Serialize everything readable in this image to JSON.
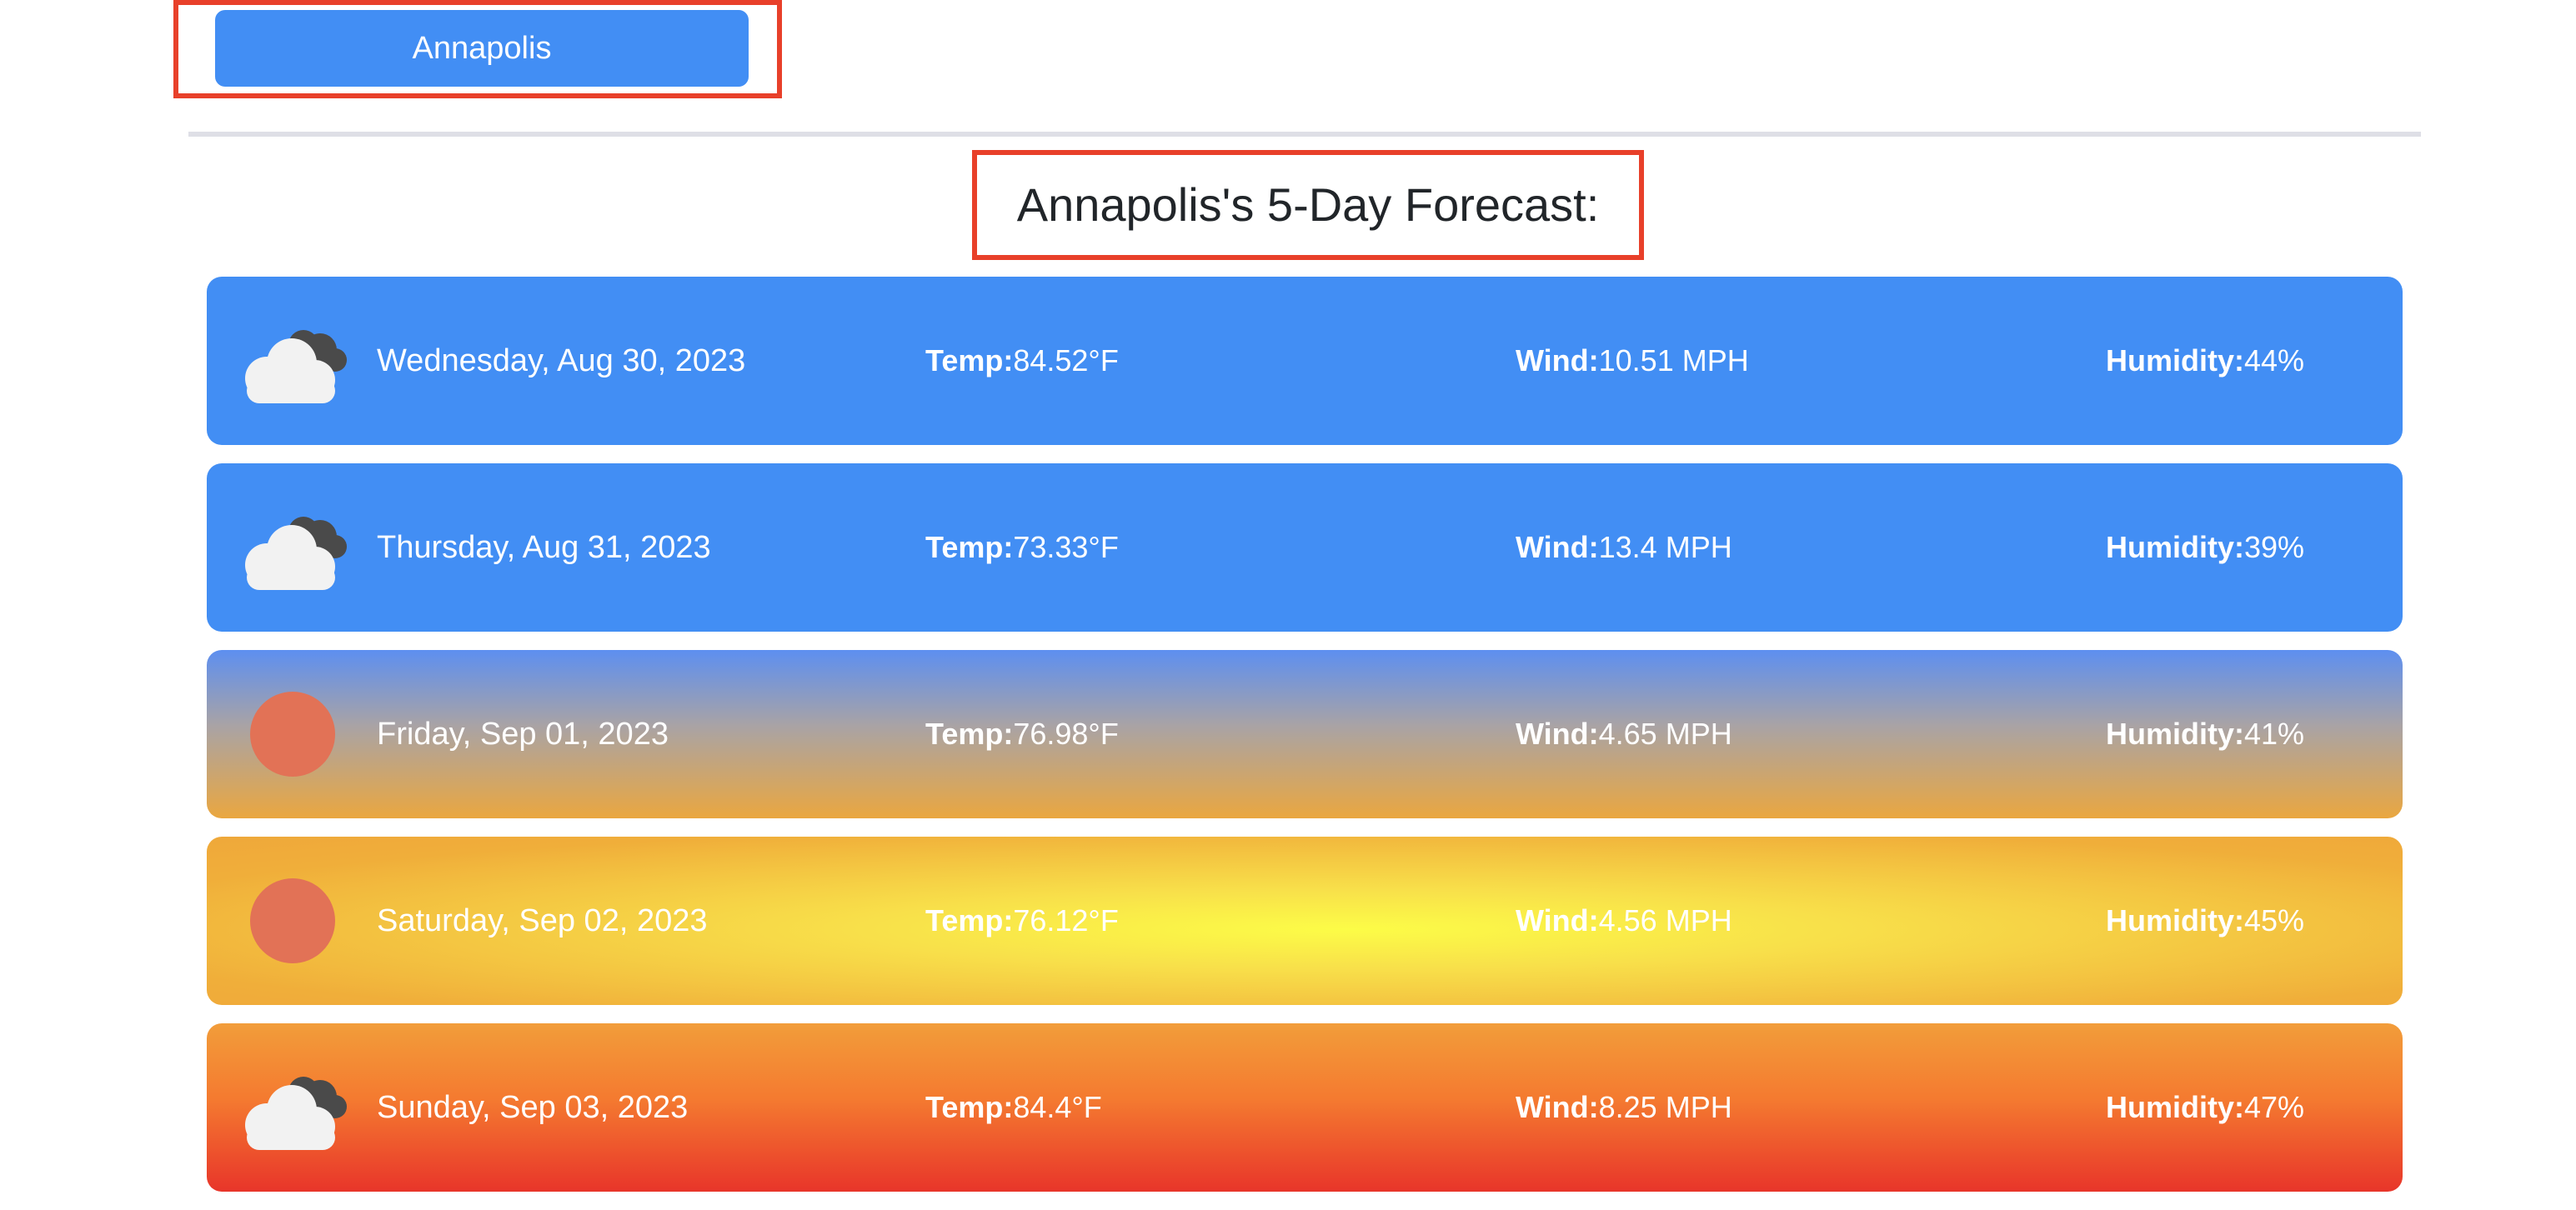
{
  "history": {
    "buttons": [
      {
        "label": "Annapolis"
      }
    ]
  },
  "forecast": {
    "title": "Annapolis's 5-Day Forecast:",
    "labels": {
      "temp": "Temp:",
      "wind": "Wind:",
      "humidity": "Humidity:"
    },
    "days": [
      {
        "icon": "clouds-icon",
        "date": "Wednesday, Aug 30, 2023",
        "temp": "84.52°F",
        "wind": "10.51 MPH",
        "humidity": "44%",
        "background": "#428ef4"
      },
      {
        "icon": "clouds-icon",
        "date": "Thursday, Aug 31, 2023",
        "temp": "73.33°F",
        "wind": "13.4 MPH",
        "humidity": "39%",
        "background": "#428ef4"
      },
      {
        "icon": "sun-icon",
        "date": "Friday, Sep 01, 2023",
        "temp": "76.98°F",
        "wind": "4.65 MPH",
        "humidity": "41%",
        "background": "#eaa740"
      },
      {
        "icon": "sun-icon",
        "date": "Saturday, Sep 02, 2023",
        "temp": "76.12°F",
        "wind": "4.56 MPH",
        "humidity": "45%",
        "background": "#fcfc47"
      },
      {
        "icon": "clouds-icon",
        "date": "Sunday, Sep 03, 2023",
        "temp": "84.4°F",
        "wind": "8.25 MPH",
        "humidity": "47%",
        "background": "#e8352a"
      }
    ]
  },
  "colors": {
    "accent": "#428ef4",
    "highlight_border": "#e8402a",
    "sun": "#e27256"
  }
}
